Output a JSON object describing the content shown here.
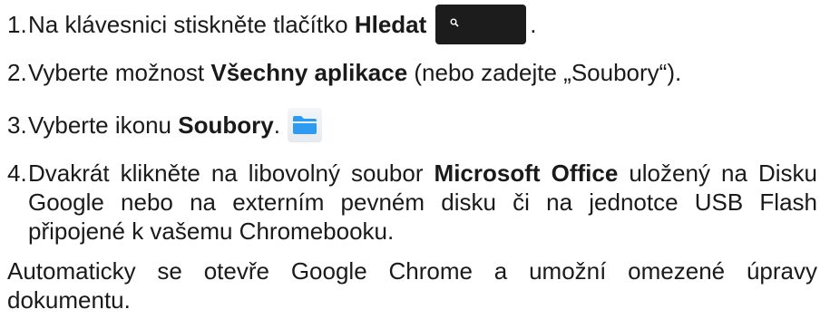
{
  "steps": [
    {
      "number": "1.",
      "before": "Na klávesnici stiskněte tlačítko ",
      "bold": "Hledat",
      "after": ".",
      "icon": "search-key-icon"
    },
    {
      "number": "2.",
      "before": "Vyberte možnost ",
      "bold": "Všechny aplikace",
      "after": " (nebo zadejte „Soubory“)."
    },
    {
      "number": "3.",
      "before": "Vyberte ikonu ",
      "bold": "Soubory",
      "after": ".",
      "icon": "files-app-icon"
    },
    {
      "number": "4.",
      "before": "Dvakrát klikněte na libovolný soubor ",
      "bold": "Microsoft Office",
      "after": " uložený na Disku Google nebo na externím pevném disku či na jednotce USB Flash připojené k vašemu Chromebooku."
    }
  ],
  "closing": "Automaticky se otevře Google Chrome a umožní omezené úpravy dokumentu.",
  "colors": {
    "text": "#1a1a1a",
    "search_key_bg": "#1c1c1c",
    "folder_blue": "#2f9bf0"
  }
}
